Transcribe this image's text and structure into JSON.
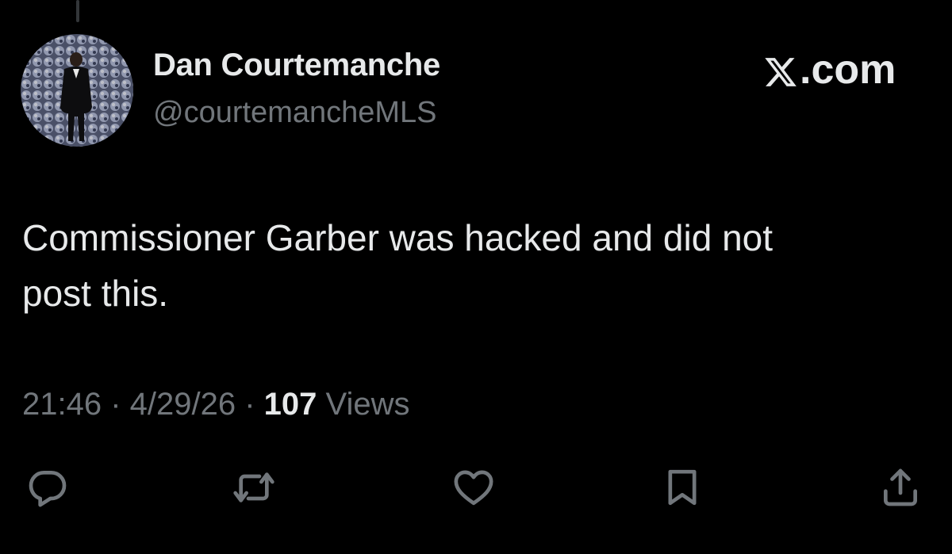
{
  "author": {
    "name": "Dan Courtemanche",
    "handle": "@courtemancheMLS"
  },
  "brand": {
    "label": ".com",
    "logo_icon": "x-logo-icon"
  },
  "tweet": {
    "text": "Commissioner Garber was hacked and did not\npost this."
  },
  "meta": {
    "time": "21:46",
    "separator": " · ",
    "date": "4/29/26",
    "views_count": "107",
    "views_label": " Views"
  },
  "actions": [
    {
      "icon": "reply-icon"
    },
    {
      "icon": "repost-icon"
    },
    {
      "icon": "like-icon"
    },
    {
      "icon": "bookmark-icon"
    },
    {
      "icon": "share-icon"
    }
  ],
  "colors": {
    "background": "#000000",
    "primary_text": "#e7e9ea",
    "secondary_text": "#71767b"
  }
}
